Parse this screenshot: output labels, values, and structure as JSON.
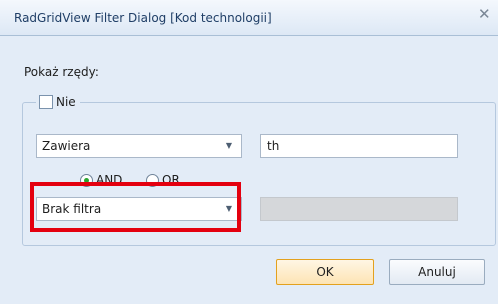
{
  "window": {
    "title": "RadGridView Filter Dialog [Kod technologii]",
    "close_icon": "close-icon"
  },
  "filter": {
    "section_label": "Pokaż rzędy:",
    "negate_label": "Nie",
    "negate_checked": false,
    "operator1": {
      "selected": "Zawiera"
    },
    "value1": "th",
    "logic": {
      "and_label": "AND",
      "or_label": "OR",
      "selected": "AND"
    },
    "operator2": {
      "selected": "Brak filtra"
    },
    "value2": ""
  },
  "buttons": {
    "ok_label": "OK",
    "cancel_label": "Anuluj"
  },
  "colors": {
    "highlight": "#e4000f",
    "accent": "#e3a11e",
    "radio_checked": "#2aa52e"
  }
}
